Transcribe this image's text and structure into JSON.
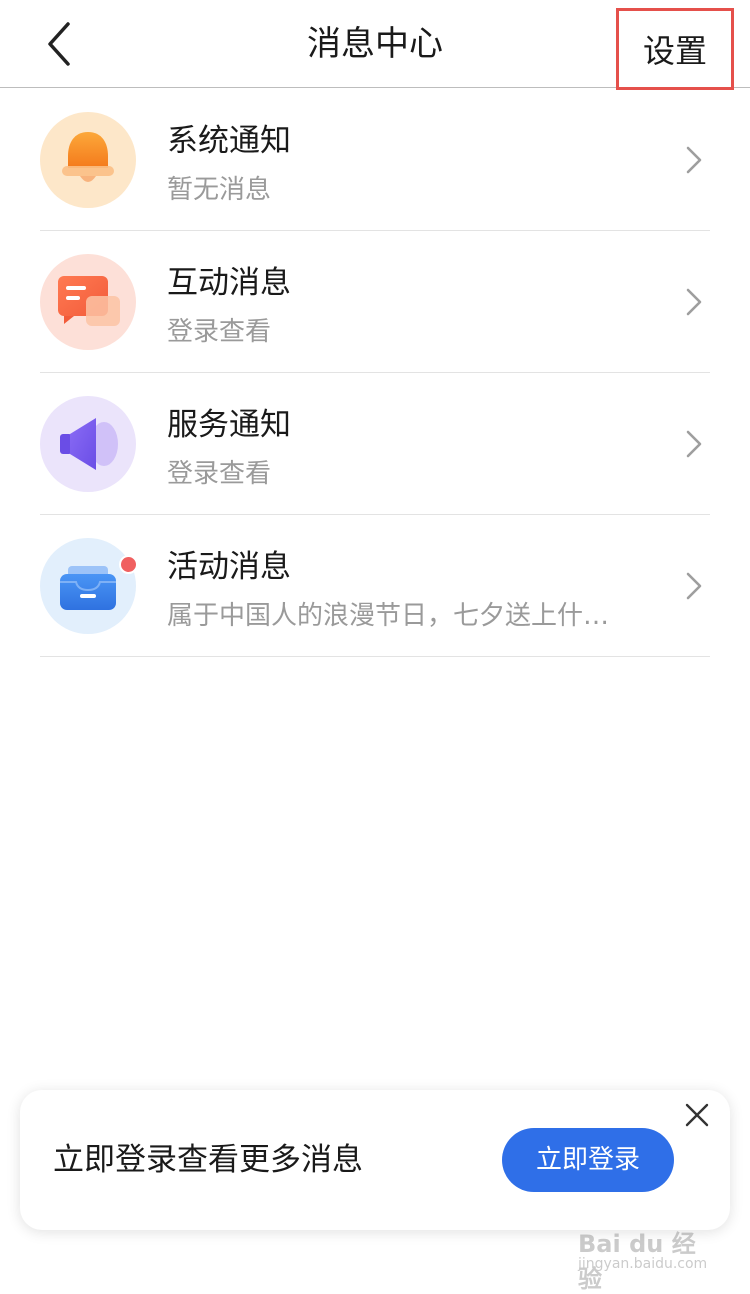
{
  "header": {
    "title": "消息中心",
    "settings_label": "设置",
    "back_icon": "chevron-left-icon"
  },
  "messages": [
    {
      "title": "系统通知",
      "subtitle": "暂无消息",
      "icon": "bell-icon",
      "icon_bg": "#fde7c9"
    },
    {
      "title": "互动消息",
      "subtitle": "登录查看",
      "icon": "chat-bubble-icon",
      "icon_bg": "#fde0d8"
    },
    {
      "title": "服务通知",
      "subtitle": "登录查看",
      "icon": "speaker-icon",
      "icon_bg": "#ebe4fb"
    },
    {
      "title": "活动消息",
      "subtitle": "属于中国人的浪漫节日，七夕送上什…",
      "icon": "inbox-icon",
      "icon_bg": "#e2effc",
      "has_unread_dot": true
    }
  ],
  "login_banner": {
    "text": "立即登录查看更多消息",
    "button_label": "立即登录",
    "close_icon": "close-icon"
  },
  "watermark": {
    "logo_text": "Bai du 经验",
    "url_text": "jingyan.baidu.com"
  },
  "colors": {
    "accent": "#2f6fe8",
    "highlight_box": "#e5504b",
    "unread_dot": "#f06060",
    "subtitle_text": "#9a9a9a"
  }
}
